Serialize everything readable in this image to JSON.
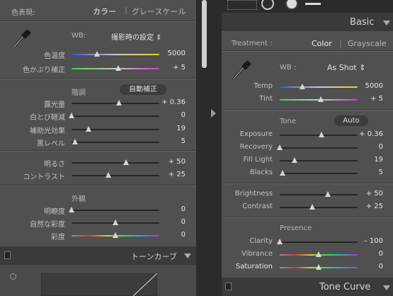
{
  "left": {
    "treatment": {
      "label": "色表現:",
      "color": "カラー",
      "divider": "|",
      "gray": "グレースケール"
    },
    "wb": {
      "label": "WB:",
      "value": "撮影時の設定 ⇕"
    },
    "temp": {
      "label": "色温度",
      "value": "5000"
    },
    "tint": {
      "label": "色かぶり補正",
      "value": "+ 5"
    },
    "tone_header": "階調",
    "auto": "自動補正",
    "exposure": {
      "label": "露光量",
      "value": "+ 0.36"
    },
    "recovery": {
      "label": "白とび軽減",
      "value": "0"
    },
    "fill": {
      "label": "補助光効果",
      "value": "19"
    },
    "blacks": {
      "label": "黒レベル",
      "value": "5"
    },
    "brightness": {
      "label": "明るさ",
      "value": "+ 50"
    },
    "contrast": {
      "label": "コントラスト",
      "value": "+ 25"
    },
    "presence_header": "外観",
    "clarity": {
      "label": "明瞭度",
      "value": "0"
    },
    "vibrance": {
      "label": "自然な彩度",
      "value": "0"
    },
    "saturation": {
      "label": "彩度",
      "value": "0"
    },
    "tone_curve": "トーンカーブ"
  },
  "right": {
    "panel_title": "Basic",
    "treatment": {
      "label": "Treatment :",
      "color": "Color",
      "divider": "|",
      "gray": "Grayscale"
    },
    "wb": {
      "label": "WB :",
      "value": "As Shot ⇕"
    },
    "temp": {
      "label": "Temp",
      "value": "5000"
    },
    "tint": {
      "label": "Tint",
      "value": "+ 5"
    },
    "tone_header": "Tone",
    "auto": "Auto",
    "exposure": {
      "label": "Exposure",
      "value": "+ 0.36"
    },
    "recovery": {
      "label": "Recovery",
      "value": "0"
    },
    "fill": {
      "label": "Fill Light",
      "value": "19"
    },
    "blacks": {
      "label": "Blacks",
      "value": "5"
    },
    "brightness": {
      "label": "Brightness",
      "value": "+ 50"
    },
    "contrast": {
      "label": "Contrast",
      "value": "+ 25"
    },
    "presence_header": "Presence",
    "clarity": {
      "label": "Clarity",
      "value": "– 100"
    },
    "vibrance": {
      "label": "Vibrance",
      "value": "0"
    },
    "saturation": {
      "label": "Saturation",
      "value": "0"
    },
    "tone_curve": "Tone Curve"
  },
  "sliders": {
    "temp": 0.29,
    "tint": 0.53,
    "exposure": 0.54,
    "recovery": 0.0,
    "fill": 0.19,
    "blacks": 0.04,
    "brightness": 0.62,
    "contrast": 0.42,
    "clarity_left": 0.0,
    "clarity_right": 0.0,
    "vibrance": 0.5,
    "saturation": 0.5
  },
  "colors": {
    "temp_gradient": [
      "#3a5ad8",
      "#c8c8c8",
      "#d8d43a"
    ],
    "tint_gradient": [
      "#3ad84a",
      "#c8c8c8",
      "#d03ad8"
    ],
    "sat_gradient": [
      "#909090",
      "#d03a3a",
      "#d8d03a",
      "#3ad84a",
      "#3a9ad8",
      "#b03ad8"
    ]
  }
}
